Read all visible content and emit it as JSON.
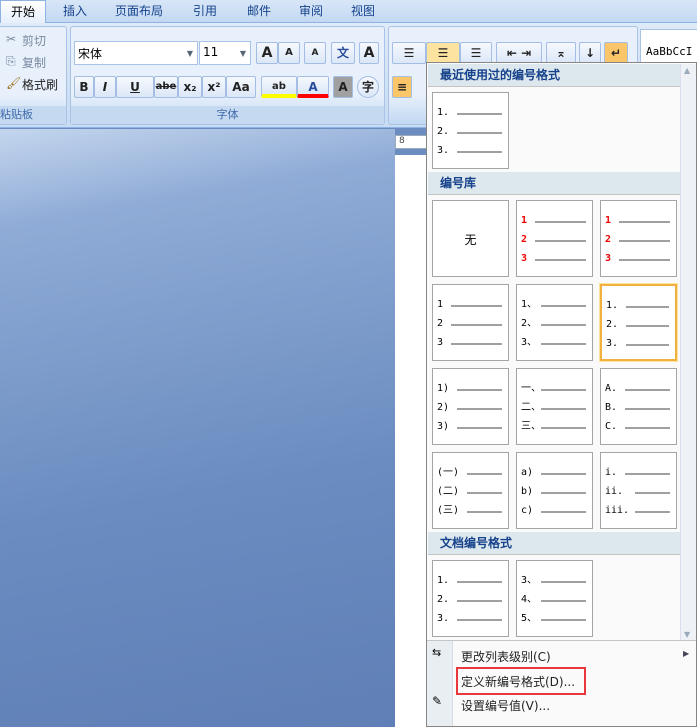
{
  "tabs": [
    "开始",
    "插入",
    "页面布局",
    "引用",
    "邮件",
    "审阅",
    "视图"
  ],
  "clipboard": {
    "cut": "剪切",
    "copy": "复制",
    "format_painter": "格式刷",
    "label": "粘贴板"
  },
  "font": {
    "name": "宋体",
    "size": "11",
    "label": "字体",
    "bold": "B",
    "italic": "I",
    "underline": "U",
    "strike": "abe",
    "sub": "x₂",
    "sup": "x²",
    "case": "Aa",
    "grow": "A",
    "shrink": "A",
    "clear": "A",
    "phonetic": "文",
    "border": "A",
    "highlight": "ab",
    "color": "A",
    "shade": "A",
    "enclose": "字",
    "highlight_color": "#ffff00",
    "font_color": "#ff0000"
  },
  "styles": {
    "preview": "AaBbCcI"
  },
  "ruler": {
    "mark": "8"
  },
  "menu": {
    "recent_header": "最近使用过的编号格式",
    "library_header": "编号库",
    "document_header": "文档编号格式",
    "recent": [
      {
        "rows": [
          "1.",
          "2.",
          "3."
        ]
      }
    ],
    "library": [
      {
        "none": "无"
      },
      {
        "rows": [
          "1",
          "2",
          "3"
        ],
        "red": true
      },
      {
        "rows": [
          "1",
          "2",
          "3"
        ],
        "red": true
      },
      {
        "rows": [
          "1",
          "2",
          "3"
        ]
      },
      {
        "rows": [
          "1、",
          "2、",
          "3、"
        ]
      },
      {
        "rows": [
          "1.",
          "2.",
          "3."
        ],
        "selected": true
      },
      {
        "rows": [
          "1)",
          "2)",
          "3)"
        ]
      },
      {
        "rows": [
          "一、",
          "二、",
          "三、"
        ]
      },
      {
        "rows": [
          "A.",
          "B.",
          "C."
        ]
      },
      {
        "rows": [
          "(一)",
          "(二)",
          "(三)"
        ]
      },
      {
        "rows": [
          "a)",
          "b)",
          "c)"
        ]
      },
      {
        "rows": [
          "i.",
          "ii.",
          "iii."
        ]
      }
    ],
    "document": [
      {
        "rows": [
          "1.",
          "2.",
          "3."
        ]
      },
      {
        "rows": [
          "3、",
          "4、",
          "5、"
        ]
      }
    ],
    "items": {
      "change_level": "更改列表级别(C)",
      "define_new": "定义新编号格式(D)...",
      "set_value": "设置编号值(V)..."
    },
    "highlight_color": "#e8383d"
  }
}
